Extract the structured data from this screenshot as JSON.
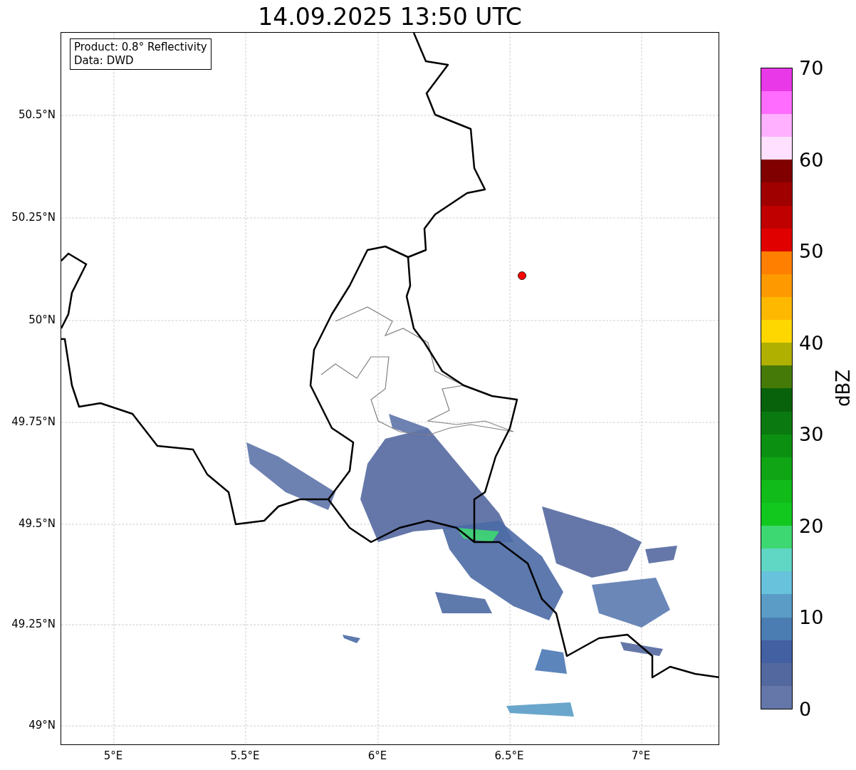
{
  "title": "14.09.2025 13:50 UTC",
  "info_box": [
    "Product: 0.8° Reflectivity",
    "Data: DWD"
  ],
  "lat_ticks": [
    "50.5°N",
    "50.25°N",
    "50°N",
    "49.75°N",
    "49.5°N",
    "49.25°N",
    "49°N"
  ],
  "lon_ticks": [
    "5°E",
    "5.5°E",
    "6°E",
    "6.5°E",
    "7°E"
  ],
  "colorbar": {
    "label": "dBZ",
    "ticks": [
      "70",
      "60",
      "50",
      "40",
      "30",
      "20",
      "10",
      "0"
    ],
    "segments": [
      {
        "color": "#6577a8"
      },
      {
        "color": "#5468a0"
      },
      {
        "color": "#4360a3"
      },
      {
        "color": "#4b7db3"
      },
      {
        "color": "#5a9cc6"
      },
      {
        "color": "#68c2dc"
      },
      {
        "color": "#60d6c4"
      },
      {
        "color": "#3ed872"
      },
      {
        "color": "#12c81e"
      },
      {
        "color": "#10bb1a"
      },
      {
        "color": "#0fa515"
      },
      {
        "color": "#0c9012"
      },
      {
        "color": "#0a7a10"
      },
      {
        "color": "#08620c"
      },
      {
        "color": "#467a08"
      },
      {
        "color": "#b0b000"
      },
      {
        "color": "#ffd700"
      },
      {
        "color": "#ffb800"
      },
      {
        "color": "#ff9900"
      },
      {
        "color": "#ff7f00"
      },
      {
        "color": "#e00000"
      },
      {
        "color": "#c00000"
      },
      {
        "color": "#a00000"
      },
      {
        "color": "#800000"
      },
      {
        "color": "#ffe0ff"
      },
      {
        "color": "#ffb0ff"
      },
      {
        "color": "#ff6cff"
      },
      {
        "color": "#e838e8"
      }
    ]
  }
}
